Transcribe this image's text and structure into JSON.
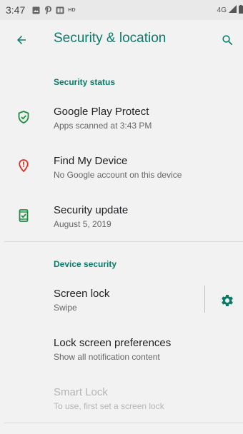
{
  "status_bar": {
    "time": "3:47",
    "hd": "HD",
    "network": "4G",
    "icons": [
      "image-icon",
      "pinterest-icon",
      "app-icon",
      "hd-icon",
      "signal-icon",
      "battery-icon"
    ]
  },
  "header": {
    "title": "Security & location",
    "back_icon": "arrow-back-icon",
    "search_icon": "search-icon"
  },
  "sections": [
    {
      "title": "Security status",
      "items": [
        {
          "title": "Google Play Protect",
          "subtitle": "Apps scanned at 3:43 PM",
          "icon": "shield-check-icon",
          "icon_color": "#1e8e3e"
        },
        {
          "title": "Find My Device",
          "subtitle": "No Google account on this device",
          "icon": "location-alert-icon",
          "icon_color": "#d93025"
        },
        {
          "title": "Security update",
          "subtitle": "August 5, 2019",
          "icon": "phone-check-icon",
          "icon_color": "#1e8e3e"
        }
      ]
    },
    {
      "title": "Device security",
      "items": [
        {
          "title": "Screen lock",
          "subtitle": "Swipe",
          "action_icon": "gear-icon"
        },
        {
          "title": "Lock screen preferences",
          "subtitle": "Show all notification content"
        },
        {
          "title": "Smart Lock",
          "subtitle": "To use, first set a screen lock",
          "disabled": true
        }
      ]
    }
  ],
  "colors": {
    "accent": "#0b7a6b",
    "background": "#f2f2f2",
    "status_bar": "#e9e9e9",
    "text_primary": "#202124",
    "text_secondary": "#666666",
    "text_disabled": "#b5b5b5",
    "green": "#1e8e3e",
    "red": "#d93025"
  }
}
